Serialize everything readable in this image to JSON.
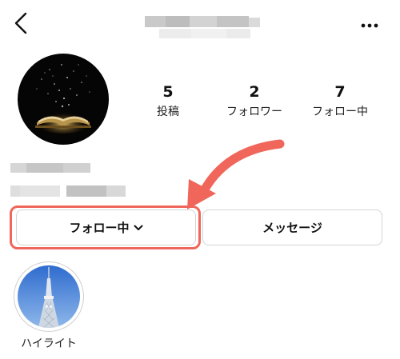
{
  "header": {
    "back_icon": "chevron-left-icon",
    "more_icon": "more-horizontal-icon"
  },
  "profile": {
    "stats": [
      {
        "value": "5",
        "label": "投稿"
      },
      {
        "value": "2",
        "label": "フォロワー"
      },
      {
        "value": "7",
        "label": "フォロー中"
      }
    ]
  },
  "actions": {
    "following_label": "フォロー中",
    "message_label": "メッセージ"
  },
  "highlights": [
    {
      "label": "ハイライト"
    }
  ],
  "colors": {
    "annotation": "#f0665b",
    "button_border": "#d4d4d4"
  }
}
